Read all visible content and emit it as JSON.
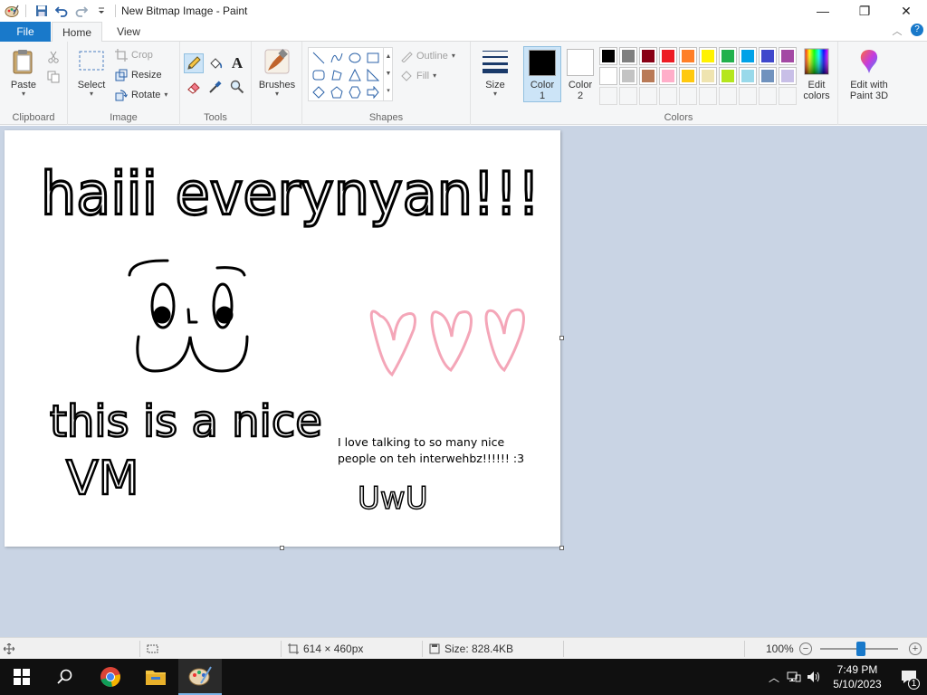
{
  "window": {
    "title": "New Bitmap Image - Paint",
    "minimize_glyph": "—",
    "maximize_glyph": "❐",
    "close_glyph": "✕"
  },
  "tabs": {
    "file": "File",
    "home": "Home",
    "view": "View"
  },
  "ribbon": {
    "clipboard": {
      "label": "Clipboard",
      "paste": "Paste"
    },
    "image": {
      "label": "Image",
      "select": "Select",
      "crop": "Crop",
      "resize": "Resize",
      "rotate": "Rotate"
    },
    "tools": {
      "label": "Tools"
    },
    "brushes": {
      "label": "Brushes"
    },
    "shapes": {
      "label": "Shapes",
      "outline": "Outline",
      "fill": "Fill"
    },
    "size": {
      "label": "Size"
    },
    "colors": {
      "label": "Colors",
      "color1_line1": "Color",
      "color1_line2": "1",
      "color2_line1": "Color",
      "color2_line2": "2",
      "color1_value": "#000000",
      "color2_value": "#ffffff",
      "edit_colors_line1": "Edit",
      "edit_colors_line2": "colors",
      "paint3d_line1": "Edit with",
      "paint3d_line2": "Paint 3D",
      "palette_row1": [
        "#000000",
        "#7f7f7f",
        "#880015",
        "#ed1c24",
        "#ff7f27",
        "#fff200",
        "#22b14c",
        "#00a2e8",
        "#3f48cc",
        "#a349a4"
      ],
      "palette_row2": [
        "#ffffff",
        "#c3c3c3",
        "#b97a57",
        "#ffaec9",
        "#ffc90e",
        "#efe4b0",
        "#b5e61d",
        "#99d9ea",
        "#7092be",
        "#c8bfe7"
      ],
      "palette_row3": [
        "",
        "",
        "",
        "",
        "",
        "",
        "",
        "",
        "",
        ""
      ]
    }
  },
  "canvas": {
    "drawn_heading": "haiii everynyan!!! :D",
    "drawn_line1": "this is a nice",
    "drawn_line2": "VM",
    "text_box_line1": "I love talking to so many nice",
    "text_box_line2": "people on teh interwehbz!!!!!! :3",
    "drawn_signature": "UwU"
  },
  "statusbar": {
    "dimensions": "614 × 460px",
    "file_size": "Size: 828.4KB",
    "zoom": "100%"
  },
  "taskbar": {
    "time": "7:49 PM",
    "date": "5/10/2023",
    "notifications_count": "1"
  }
}
